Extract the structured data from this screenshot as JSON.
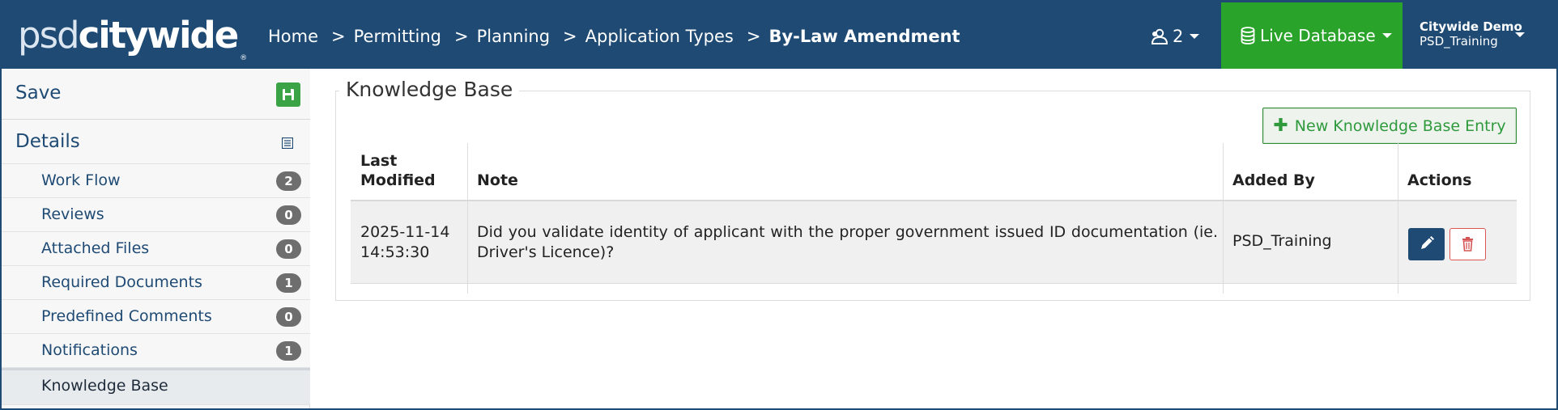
{
  "app": {
    "logo_part1": "psd",
    "logo_part2": "citywide",
    "logo_reg": "®"
  },
  "breadcrumb": {
    "items": [
      "Home",
      "Permitting",
      "Planning",
      "Application Types",
      "By-Law Amendment"
    ],
    "separator": ">"
  },
  "header": {
    "users_count": "2",
    "database_label": "Live Database",
    "user_name": "Citywide Demo",
    "user_org": "PSD_Training"
  },
  "sidebar": {
    "save_label": "Save",
    "details_label": "Details",
    "items": [
      {
        "label": "Work Flow",
        "count": "2"
      },
      {
        "label": "Reviews",
        "count": "0"
      },
      {
        "label": "Attached Files",
        "count": "0"
      },
      {
        "label": "Required Documents",
        "count": "1"
      },
      {
        "label": "Predefined Comments",
        "count": "0"
      },
      {
        "label": "Notifications",
        "count": "1"
      },
      {
        "label": "Knowledge Base"
      }
    ]
  },
  "knowledge_base": {
    "title": "Knowledge Base",
    "new_button": "New Knowledge Base Entry",
    "columns": {
      "last_modified_1": "Last",
      "last_modified_2": "Modified",
      "note": "Note",
      "added_by": "Added By",
      "actions": "Actions"
    },
    "rows": [
      {
        "date": "2025-11-14",
        "time": "14:53:30",
        "note": "Did you validate identity of applicant with the proper government issued ID documentation (ie. Driver's Licence)?",
        "added_by": "PSD_Training"
      }
    ]
  },
  "colors": {
    "navbar": "#1e4a74",
    "database_button": "#29a329",
    "save_button": "#3aa346",
    "badge": "#6e6e6e",
    "accent_green": "#2e9a3c",
    "delete_red": "#d55555"
  },
  "icons": {
    "users": "users-icon",
    "database": "database-icon",
    "save": "floppy-disk-icon",
    "details": "list-icon",
    "plus": "plus-icon",
    "edit": "pencil-icon",
    "delete": "trash-icon"
  }
}
